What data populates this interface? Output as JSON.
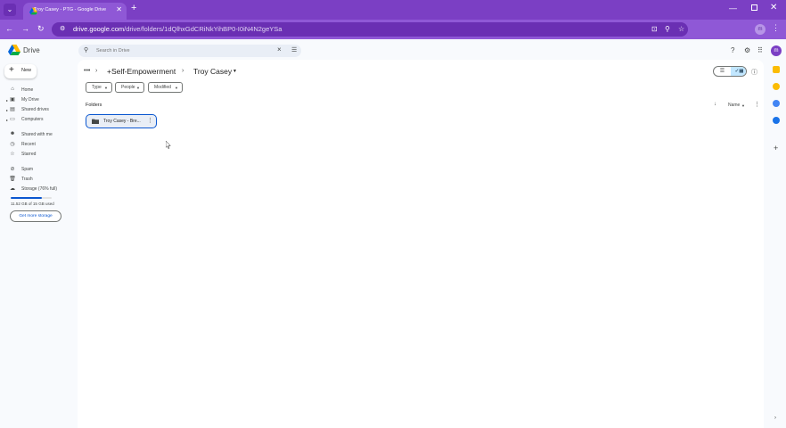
{
  "browser": {
    "tab_title": "Troy Casey - PTG - Google Drive",
    "url_host": "drive.google.com",
    "url_path": "/drive/folders/1dQlhxGdCRiNkYihBP0-I0iN4N2geYSa",
    "profile_initial": "m"
  },
  "drive": {
    "app_name": "Drive",
    "search_placeholder": "Search in Drive",
    "account_initial": "m"
  },
  "sidebar": {
    "new_label": "New",
    "items": [
      {
        "label": "Home",
        "icon": "home-icon"
      },
      {
        "label": "My Drive",
        "icon": "my-drive-icon"
      },
      {
        "label": "Shared drives",
        "icon": "shared-drives-icon"
      },
      {
        "label": "Computers",
        "icon": "computers-icon"
      },
      {
        "label": "Shared with me",
        "icon": "shared-with-me-icon"
      },
      {
        "label": "Recent",
        "icon": "recent-icon"
      },
      {
        "label": "Starred",
        "icon": "starred-icon"
      },
      {
        "label": "Spam",
        "icon": "spam-icon"
      },
      {
        "label": "Trash",
        "icon": "trash-icon"
      },
      {
        "label": "Storage (76% full)",
        "icon": "storage-icon"
      }
    ],
    "storage_used": "11.52 GB of 15 GB used",
    "storage_fraction": 0.76,
    "get_storage_label": "Get more storage"
  },
  "breadcrumb": {
    "parent": "+Self-Empowerment",
    "current": "Troy Casey"
  },
  "filters": [
    {
      "label": "Type"
    },
    {
      "label": "People"
    },
    {
      "label": "Modified"
    }
  ],
  "content": {
    "folders_heading": "Folders",
    "sort_label": "Name",
    "folders": [
      {
        "name": "Troy Casey - Bre..."
      }
    ]
  },
  "colors": {
    "chrome_purple": "#7b3fc4",
    "accent_blue": "#0b57d0",
    "selected_chip": "#c2e7ff"
  }
}
